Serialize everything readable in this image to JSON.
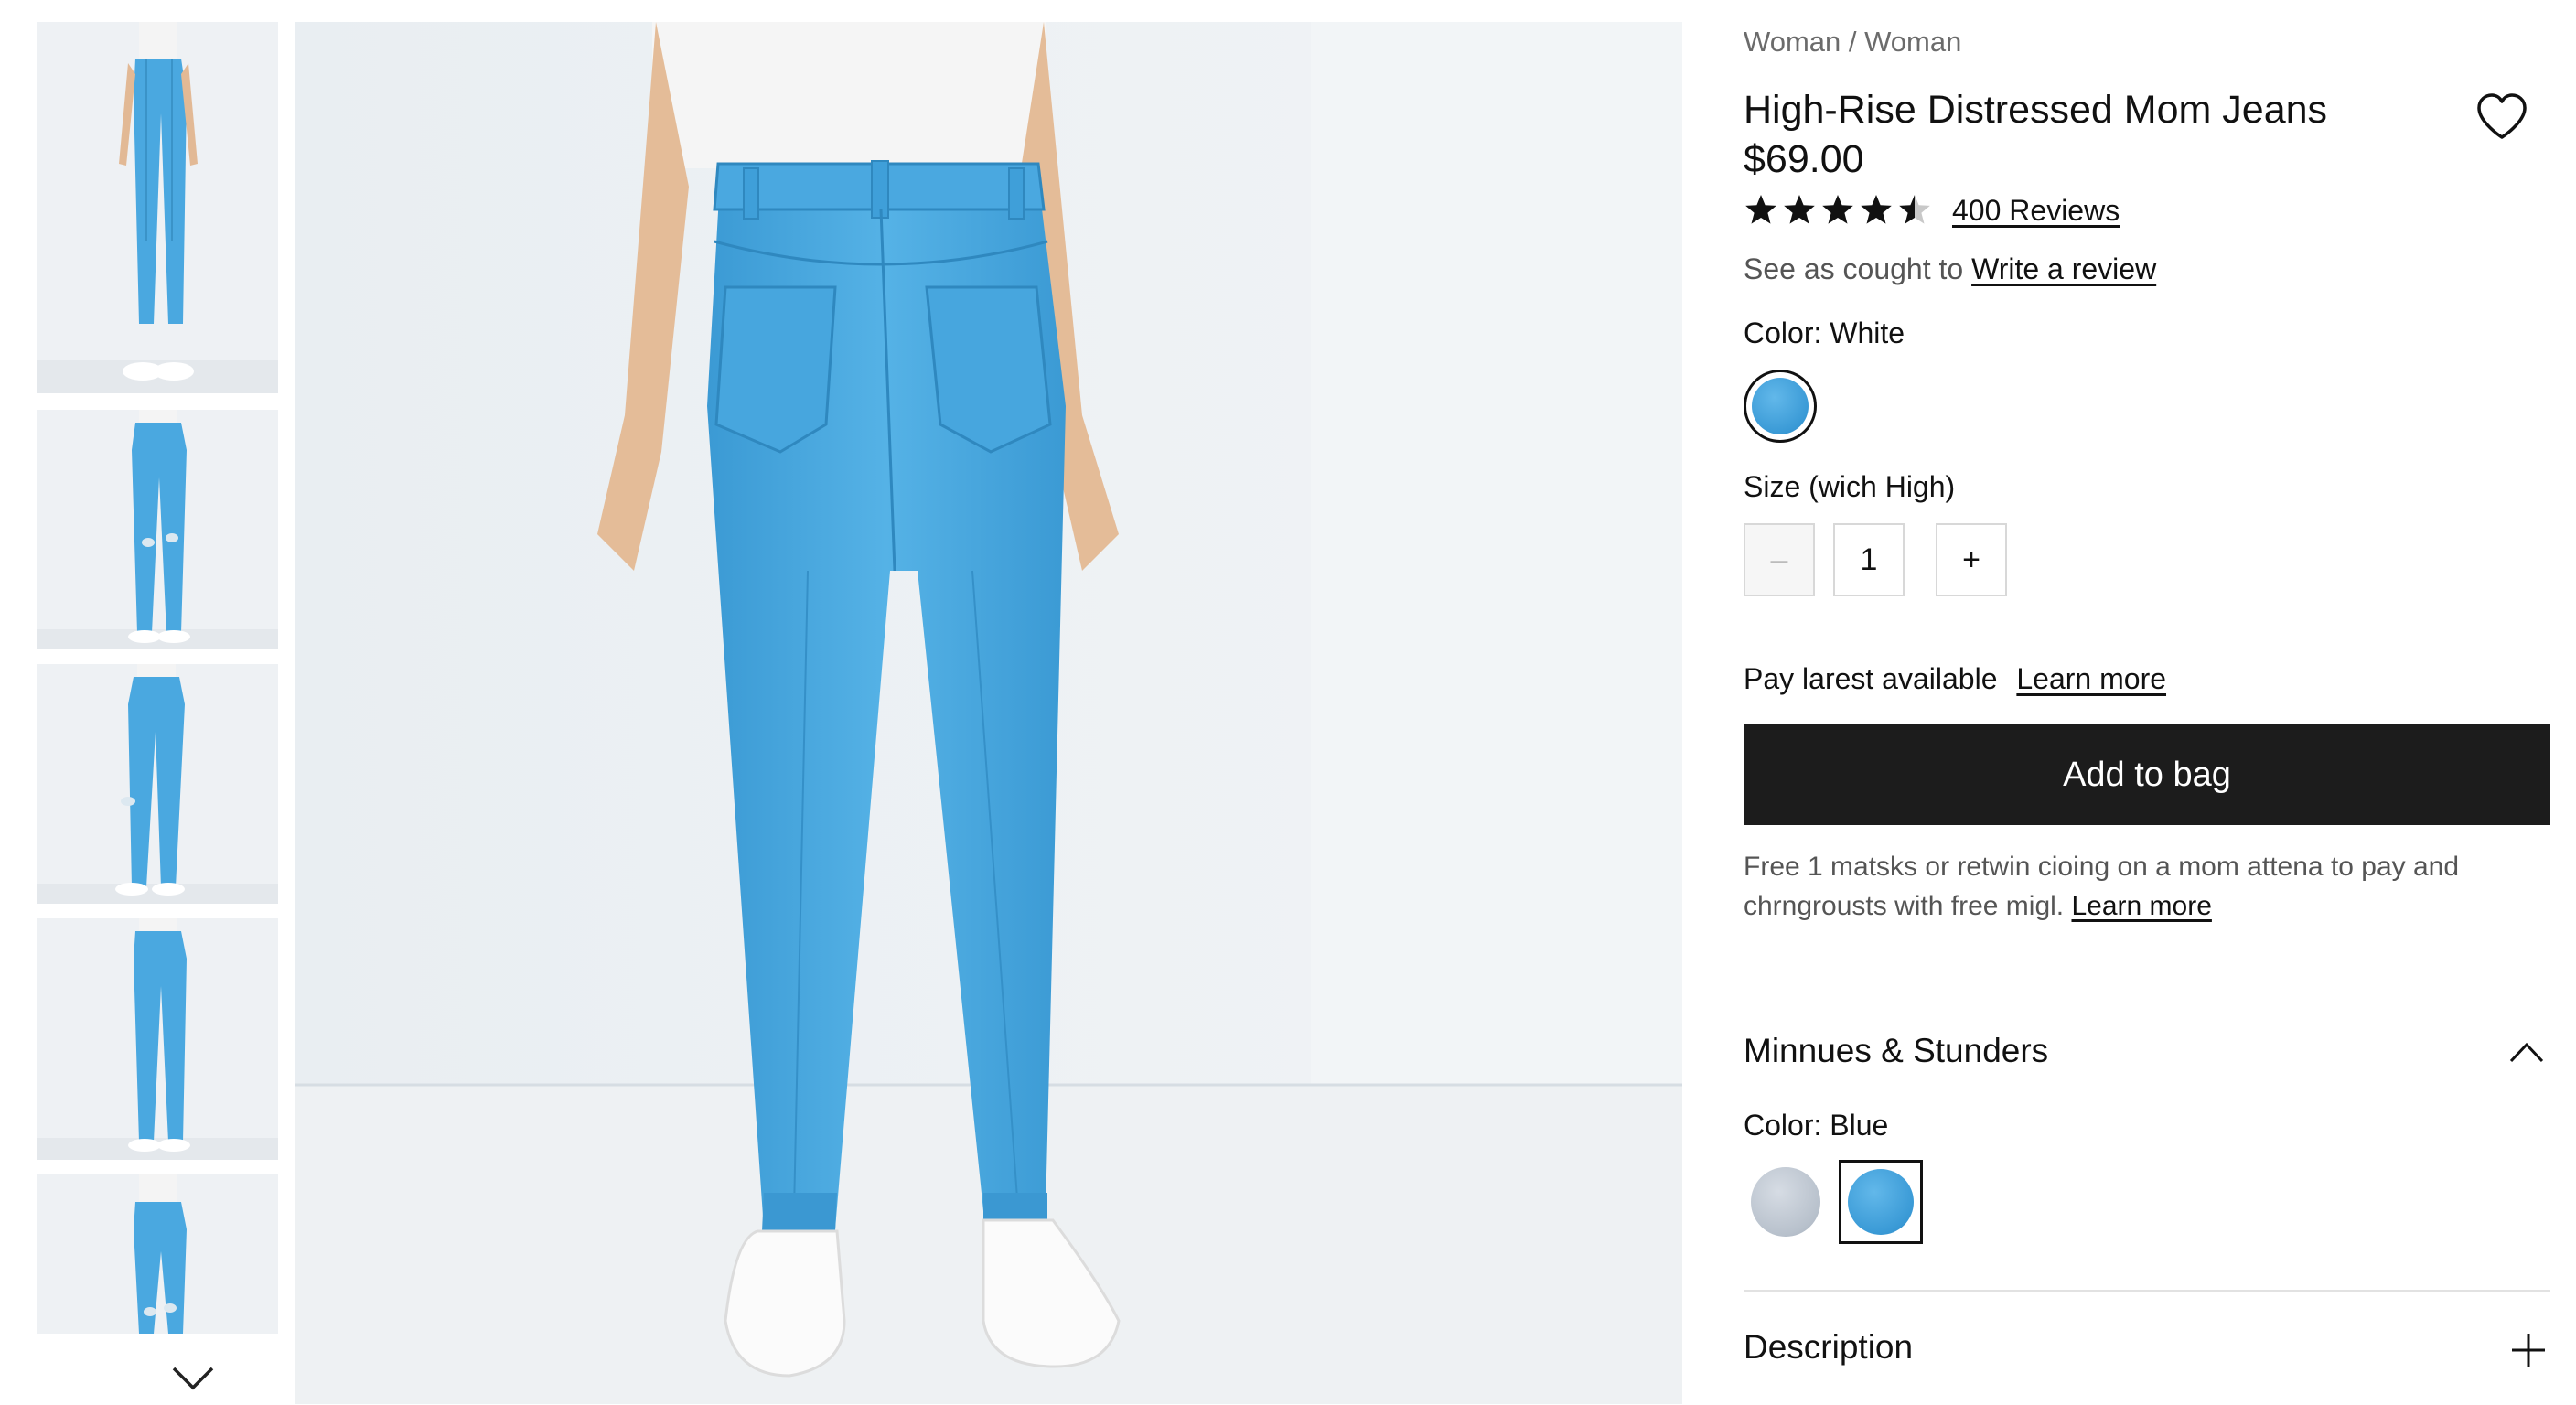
{
  "breadcrumb": "Woman / Woman",
  "product": {
    "title": "High-Rise Distressed Mom Jeans",
    "price": "$69.00",
    "rating": 4.5,
    "reviews_link": "400 Reviews",
    "subline_text": "See as cought to",
    "write_review_link": "Write a review"
  },
  "color_selector": {
    "label": "Color: White",
    "swatch_color": "#4aa8e0"
  },
  "size_selector": {
    "label": "Size (wich High)",
    "minus": "–",
    "quantity": "1",
    "plus": "+"
  },
  "payment": {
    "text": "Pay larest available",
    "learn_more": "Learn more"
  },
  "add_to_bag": "Add to bag",
  "shipping_note": {
    "text": "Free 1 matsks or retwin cioing on a mom attena to pay and chrngrousts with free migl.",
    "learn_more": "Learn more"
  },
  "accordion": {
    "title": "Minnues & Stunders",
    "color_label": "Color: Blue",
    "swatches": [
      "#b8c1cc",
      "#4aa8e0"
    ]
  },
  "description_title": "Description",
  "colors": {
    "denim": "#4aa8e0",
    "button_bg": "#1c1c1c",
    "background": "#eef2f5"
  },
  "icons": {
    "wishlist": "heart-icon",
    "thumbnail_nav": "chevron-down-icon",
    "accordion_toggle": "chevron-up-icon",
    "description_toggle": "plus-icon"
  }
}
